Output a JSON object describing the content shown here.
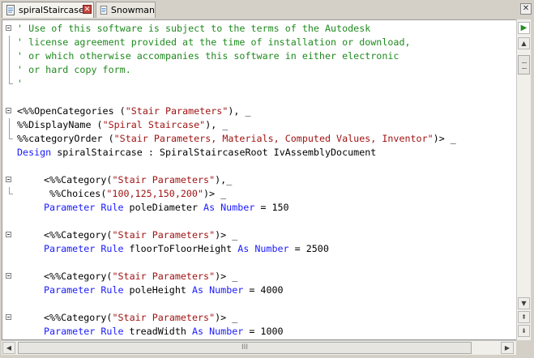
{
  "tabs": [
    {
      "label": "spiralStaircase",
      "active": true
    },
    {
      "label": "Snowman",
      "active": false
    }
  ],
  "tab_close_glyph": "✕",
  "window_close_glyph": "✕",
  "icons": {
    "file": "document-icon",
    "run": "play-icon"
  },
  "colors": {
    "comment": "#1f8a1f",
    "keyword": "#1a1aff",
    "string": "#a01414",
    "text": "#000000"
  },
  "scroll_glyphs": {
    "play": "▶",
    "up": "▲",
    "down": "▼",
    "page_up": "⇞",
    "page_down": "⇟",
    "left": "◀",
    "right": "▶",
    "thumb": "III"
  },
  "code": {
    "l1": {
      "c1": "' Use of this software is subject to the terms of the Autodesk"
    },
    "l2": {
      "c1": "' license agreement provided at the time of installation or download,"
    },
    "l3": {
      "c1": "' or which otherwise accompanies this software in either electronic"
    },
    "l4": {
      "c1": "' or hard copy form."
    },
    "l5": {
      "c1": "'"
    },
    "l7": {
      "p1": "<%%OpenCategories (",
      "s1": "\"Stair Parameters\"",
      "p2": "), _"
    },
    "l8": {
      "p1": "%%DisplayName (",
      "s1": "\"Spiral Staircase\"",
      "p2": "), _"
    },
    "l9": {
      "p1": "%%categoryOrder (",
      "s1": "\"Stair Parameters, Materials, Computed Values, Inventor\"",
      "p2": ")> _"
    },
    "l10": {
      "k1": "Design",
      "p1": " spiralStaircase : SpiralStaircaseRoot IvAssemblyDocument"
    },
    "l12": {
      "p1": "<%%Category(",
      "s1": "\"Stair Parameters\"",
      "p2": "),_"
    },
    "l13": {
      "p1": "%%Choices(",
      "s1": "\"100,125,150,200\"",
      "p2": ")> _"
    },
    "l14": {
      "k1": "Parameter Rule",
      "p1": " poleDiameter ",
      "k2": "As Number",
      "p2": " = 150"
    },
    "l16": {
      "p1": "<%%Category(",
      "s1": "\"Stair Parameters\"",
      "p2": ")> _"
    },
    "l17": {
      "k1": "Parameter Rule",
      "p1": " floorToFloorHeight ",
      "k2": "As Number",
      "p2": " = 2500"
    },
    "l19": {
      "p1": "<%%Category(",
      "s1": "\"Stair Parameters\"",
      "p2": ")> _"
    },
    "l20": {
      "k1": "Parameter Rule",
      "p1": " poleHeight ",
      "k2": "As Number",
      "p2": " = 4000"
    },
    "l22": {
      "p1": "<%%Category(",
      "s1": "\"Stair Parameters\"",
      "p2": ")> _"
    },
    "l23": {
      "k1": "Parameter Rule",
      "p1": " treadWidth ",
      "k2": "As Number",
      "p2": " = 1000"
    }
  }
}
